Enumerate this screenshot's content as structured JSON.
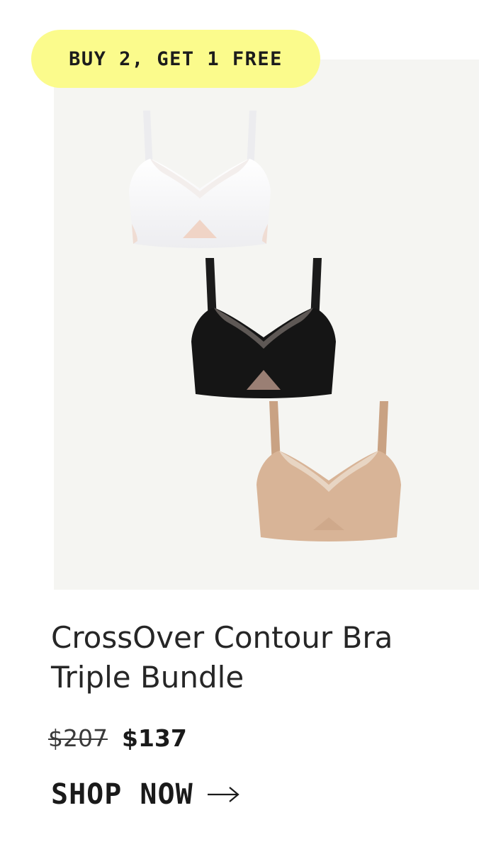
{
  "promo": {
    "badge_text": "BUY 2, GET 1 FREE",
    "badge_color": "#fbfb8c"
  },
  "product": {
    "title": "CrossOver Contour Bra Triple Bundle",
    "price_original": "$207",
    "price_sale": "$137",
    "image_background": "#f5f5f2",
    "variants": [
      {
        "color_name": "white",
        "color": "#f7f7f9",
        "accent": "#f0d4c6"
      },
      {
        "color_name": "black",
        "color": "#151515",
        "accent": "#9a7f74"
      },
      {
        "color_name": "nude",
        "color": "#d8b497",
        "accent": "#ead8c8"
      }
    ]
  },
  "cta": {
    "label": "SHOP NOW",
    "icon": "arrow-right-icon"
  }
}
